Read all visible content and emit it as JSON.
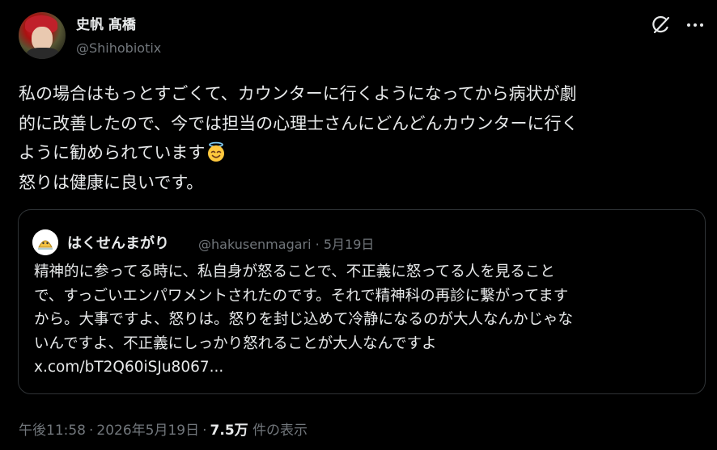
{
  "author": {
    "display_name": "史帆 髙橋",
    "handle": "@Shihobiotix"
  },
  "icons": {
    "grok": "grok-icon",
    "more": "more-icon",
    "emoji": "smiling-face-with-halo-emoji"
  },
  "post": {
    "lines": [
      "私の場合はもっとすごくて、カウンターに行くようになってから病状が劇",
      "的に改善したので、今では担当の心理士さんにどんどんカウンターに行く",
      "ように勧められています",
      "怒りは健康に良いです。"
    ]
  },
  "quoted": {
    "display_name": "はくせんまがり",
    "handle": "@hakusenmagari",
    "separator": "·",
    "date": "5月19日",
    "lines": [
      "精神的に参ってる時に、私自身が怒ることで、不正義に怒ってる人を見ること",
      "で、すっごいエンパワメントされたのです。それで精神科の再診に繋がってます",
      "から。大事ですよ、怒りは。怒りを封じ込めて冷静になるのが大人なんかじゃな",
      "いんですよ、不正義にしっかり怒れることが大人なんですよ",
      "x.com/bT2Q60iSJu8067..."
    ]
  },
  "footer": {
    "time": "午後11:58",
    "separator": "·",
    "date": "2026年5月19日",
    "views_count": "7.5万",
    "views_label": "件の表示"
  },
  "colors": {
    "background": "#000000",
    "text_primary": "#e7e9ea",
    "text_secondary": "#71767b",
    "border": "#2f3336"
  }
}
